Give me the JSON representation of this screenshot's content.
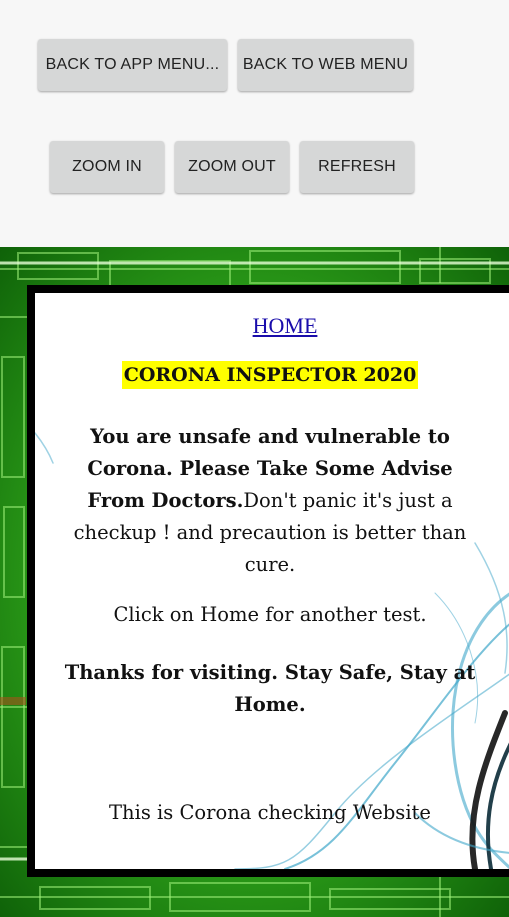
{
  "toolbar": {
    "back_app_menu": "BACK TO APP MENU...",
    "back_web_menu": "BACK TO WEB MENU",
    "zoom_in": "ZOOM IN",
    "zoom_out": "ZOOM OUT",
    "refresh": "REFRESH"
  },
  "page": {
    "home_link": "HOME",
    "title": "CORONA INSPECTOR 2020",
    "result_bold": "You are unsafe and vulnerable to Corona. Please Take Some Advise From Doctors.",
    "result_normal": "Don't panic it's just a checkup ! and precaution is better than cure.",
    "retry_text": "Click on Home for another test.",
    "thanks_text": "Thanks for visiting. Stay Safe, Stay at Home.",
    "footer_text": "This is Corona checking Website"
  },
  "colors": {
    "toolbar_bg": "#f7f7f7",
    "button_bg": "#d6d7d7",
    "web_bg": "#1f8a12",
    "title_highlight": "#ffff00",
    "link": "#1a0dab"
  }
}
